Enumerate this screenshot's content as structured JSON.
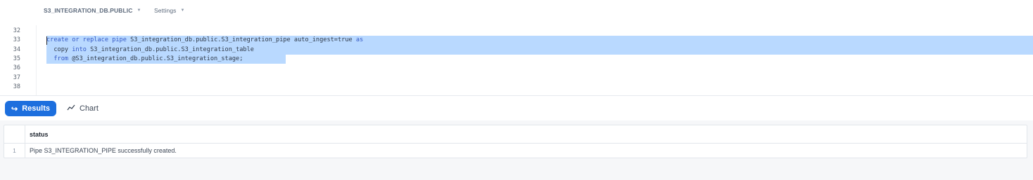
{
  "context_bar": {
    "database": "S3_INTEGRATION_DB.PUBLIC",
    "settings": "Settings",
    "caret": "▼"
  },
  "editor": {
    "line_numbers": [
      "32",
      "33",
      "34",
      "35",
      "36",
      "37",
      "38"
    ],
    "lines": [
      {
        "indent": "",
        "segments": []
      },
      {
        "indent": "",
        "segments": [
          {
            "t": "create",
            "kw": true
          },
          {
            "t": " ",
            "kw": false
          },
          {
            "t": "or",
            "kw": true
          },
          {
            "t": " ",
            "kw": false
          },
          {
            "t": "replace",
            "kw": true
          },
          {
            "t": " ",
            "kw": false
          },
          {
            "t": "pipe",
            "kw": true
          },
          {
            "t": " S3_integration_db.public.S3_integration_pipe auto_ingest=true ",
            "kw": false
          },
          {
            "t": "as",
            "kw": true
          }
        ]
      },
      {
        "indent": "  ",
        "segments": [
          {
            "t": "copy",
            "kw": false
          },
          {
            "t": " ",
            "kw": false
          },
          {
            "t": "into",
            "kw": true
          },
          {
            "t": " S3_integration_db.public.S3_integration_table",
            "kw": false
          }
        ]
      },
      {
        "indent": "  ",
        "segments": [
          {
            "t": "from",
            "kw": true
          },
          {
            "t": " @S3_integration_db.public.S3_integration_stage;",
            "kw": false
          }
        ]
      },
      {
        "indent": "",
        "segments": []
      },
      {
        "indent": "",
        "segments": []
      },
      {
        "indent": "",
        "segments": []
      }
    ]
  },
  "results_toolbar": {
    "results_label": "Results",
    "results_icon": "↪",
    "chart_label": "Chart",
    "chart_icon": "∿"
  },
  "results_table": {
    "columns": [
      "status"
    ],
    "rows": [
      {
        "index": "1",
        "status": "Pipe S3_INTEGRATION_PIPE successfully created."
      }
    ]
  },
  "colors": {
    "accent": "#1d6fde",
    "selection": "#b9d9ff",
    "keyword": "#3559c6"
  }
}
